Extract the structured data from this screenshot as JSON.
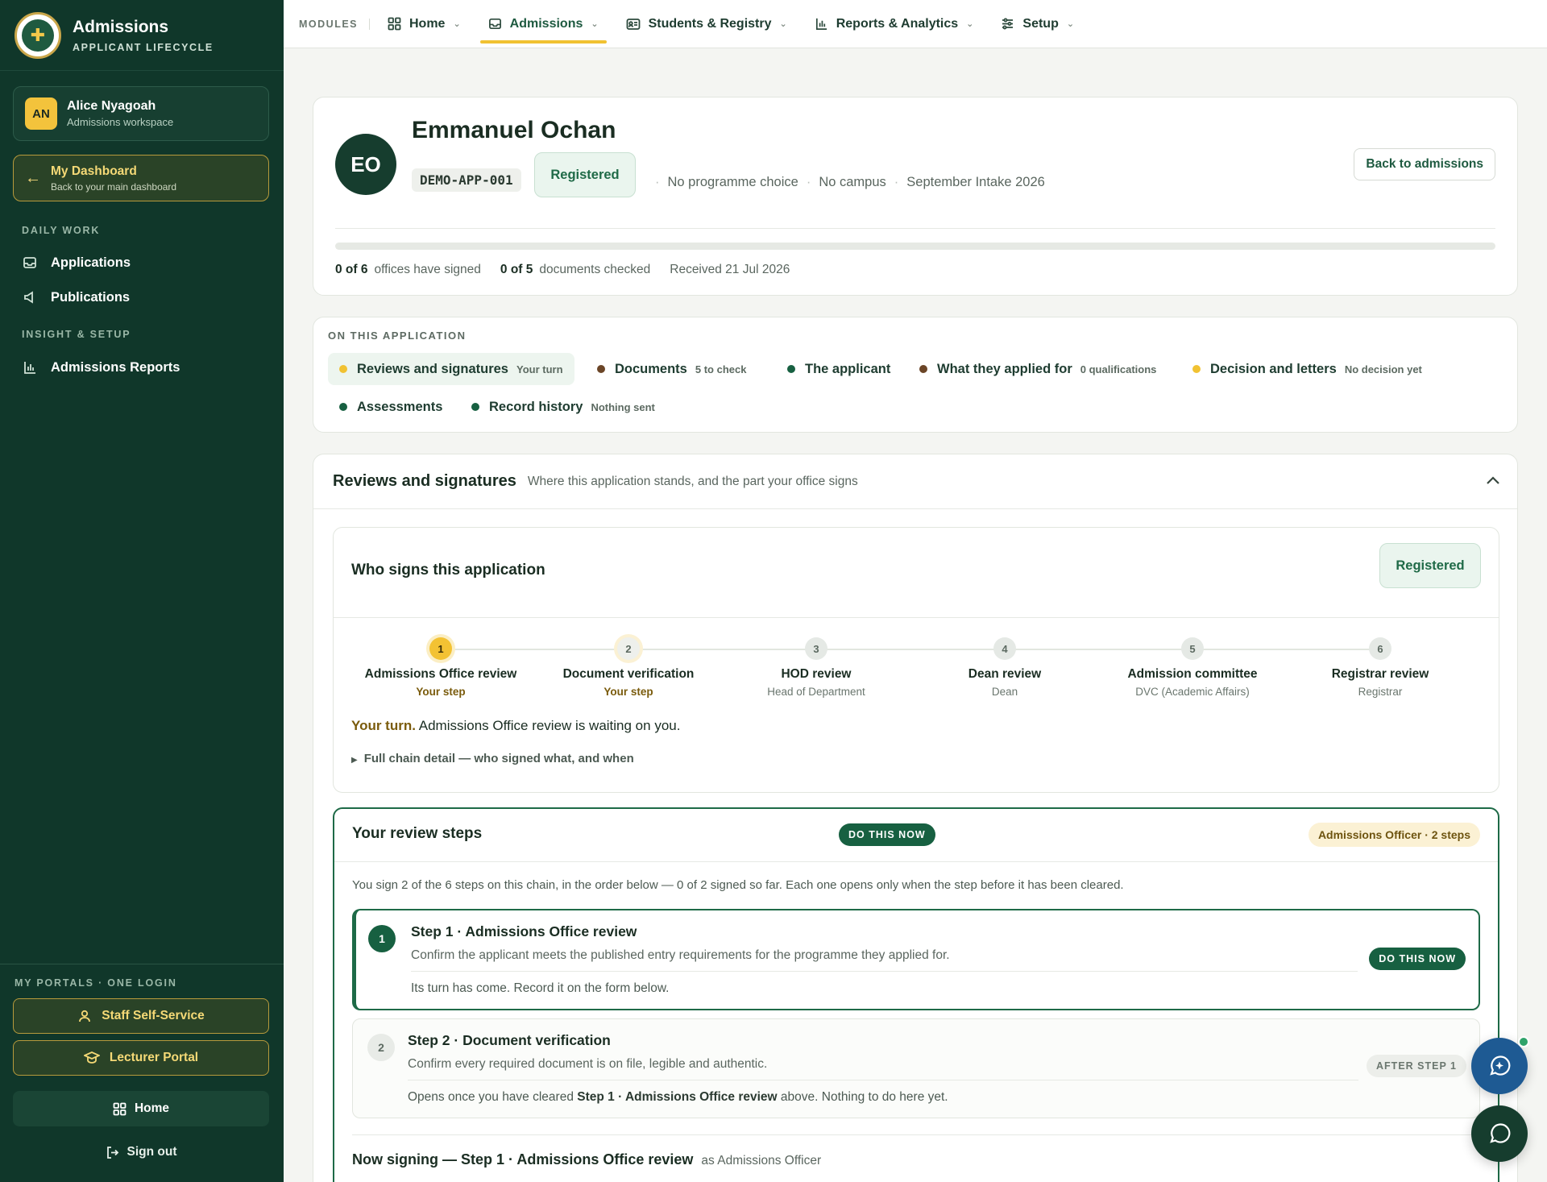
{
  "sidebar": {
    "brand_title": "Admissions",
    "brand_subtitle": "APPLICANT LIFECYCLE",
    "user": {
      "initials": "AN",
      "name": "Alice Nyagoah",
      "role": "Admissions workspace"
    },
    "dashboard": {
      "title": "My Dashboard",
      "subtitle": "Back to your main dashboard"
    },
    "section_daily": "DAILY WORK",
    "daily_items": [
      {
        "label": "Applications",
        "icon": "inbox-icon"
      },
      {
        "label": "Publications",
        "icon": "megaphone-icon"
      }
    ],
    "section_insight": "INSIGHT & SETUP",
    "insight_items": [
      {
        "label": "Admissions Reports",
        "icon": "bar-chart-icon"
      }
    ],
    "portals_label": "MY PORTALS · ONE LOGIN",
    "portals": [
      {
        "label": "Staff Self-Service",
        "icon": "user-icon"
      },
      {
        "label": "Lecturer Portal",
        "icon": "graduation-cap-icon"
      }
    ],
    "home": "Home",
    "sign_out": "Sign out"
  },
  "topnav": {
    "label": "MODULES",
    "items": [
      {
        "label": "Home",
        "icon": "grid-icon",
        "active": false
      },
      {
        "label": "Admissions",
        "icon": "inbox-icon",
        "active": true
      },
      {
        "label": "Students & Registry",
        "icon": "id-card-icon",
        "active": false
      },
      {
        "label": "Reports & Analytics",
        "icon": "bar-chart-icon",
        "active": false
      },
      {
        "label": "Setup",
        "icon": "sliders-icon",
        "active": false
      }
    ]
  },
  "applicant": {
    "initials": "EO",
    "name": "Emmanuel Ochan",
    "ref": "DEMO-APP-001",
    "status": "Registered",
    "programme": "No programme choice",
    "campus": "No campus",
    "intake": "September Intake 2026",
    "back_label": "Back to admissions",
    "offices_count": "0 of 6",
    "offices_text": "offices have signed",
    "docs_count": "0 of 5",
    "docs_text": "documents checked",
    "received": "Received 21 Jul 2026",
    "progress_fraction": 0
  },
  "on_this": {
    "title": "ON THIS APPLICATION",
    "chips": [
      {
        "label": "Reviews and signatures",
        "sub": "Your turn",
        "dot": "#f1c232",
        "active": true
      },
      {
        "label": "Documents",
        "sub": "5 to check",
        "dot": "#6b4527",
        "active": false
      },
      {
        "label": "The applicant",
        "sub": "",
        "dot": "#176041",
        "active": false
      },
      {
        "label": "What they applied for",
        "sub": "0 qualifications",
        "dot": "#6b4527",
        "active": false
      },
      {
        "label": "Decision and letters",
        "sub": "No decision yet",
        "dot": "#f1c232",
        "active": false
      },
      {
        "label": "Assessments",
        "sub": "",
        "dot": "#176041",
        "active": false
      },
      {
        "label": "Record history",
        "sub": "Nothing sent",
        "dot": "#176041",
        "active": false
      }
    ]
  },
  "reviews": {
    "title": "Reviews and signatures",
    "subtitle": "Where this application stands, and the part your office signs",
    "who_title": "Who signs this application",
    "who_status": "Registered",
    "steps": [
      {
        "num": "1",
        "name": "Admissions Office review",
        "role": "Your step",
        "state": "current"
      },
      {
        "num": "2",
        "name": "Document verification",
        "role": "Your step",
        "state": "mine"
      },
      {
        "num": "3",
        "name": "HOD review",
        "role": "Head of Department",
        "state": "other"
      },
      {
        "num": "4",
        "name": "Dean review",
        "role": "Dean",
        "state": "other"
      },
      {
        "num": "5",
        "name": "Admission committee",
        "role": "DVC (Academic Affairs)",
        "state": "other"
      },
      {
        "num": "6",
        "name": "Registrar review",
        "role": "Registrar",
        "state": "other"
      }
    ],
    "turn_prefix": "Your turn.",
    "turn_text": " Admissions Office review is waiting on you.",
    "detail_link": "Full chain detail — who signed what, and when"
  },
  "your_steps": {
    "title": "Your review steps",
    "do_now": "DO THIS NOW",
    "badge": "Admissions Officer · 2 steps",
    "intro": "You sign 2 of the 6 steps on this chain, in the order below — 0 of 2 signed so far. Each one opens only when the step before it has been cleared.",
    "step1": {
      "num": "1",
      "title": "Step 1 · Admissions Office review",
      "desc": "Confirm the applicant meets the published entry requirements for the programme they applied for.",
      "note": "Its turn has come. Record it on the form below.",
      "pill": "DO THIS NOW"
    },
    "step2": {
      "num": "2",
      "title": "Step 2 · Document verification",
      "desc": "Confirm every required document is on file, legible and authentic.",
      "note_a": "Opens once you have cleared ",
      "note_b": "Step 1 · Admissions Office review",
      "note_c": " above. Nothing to do here yet.",
      "pill": "AFTER STEP 1"
    },
    "signing_title": "Now signing — Step 1 · Admissions Office review",
    "signing_as": "as Admissions Officer"
  }
}
